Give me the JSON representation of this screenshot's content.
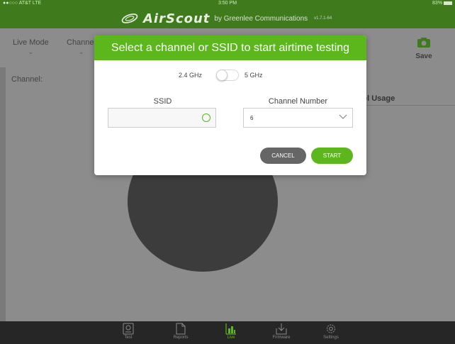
{
  "status_bar": {
    "carrier": "●●○○○ AT&T  LTE",
    "time": "3:50 PM",
    "battery": "83%"
  },
  "header": {
    "brand": "AirScout",
    "byline": "by Greenlee Communications",
    "version": "v1.7.1-64"
  },
  "toolbar": {
    "live_mode": "Live Mode",
    "channel": "Channel",
    "save": "Save"
  },
  "main": {
    "channel_label": "Channel:",
    "usage_label": "el Usage"
  },
  "modal": {
    "title": "Select a channel or SSID to start airtime testing",
    "band_left": "2.4 GHz",
    "band_right": "5 GHz",
    "ssid_label": "SSID",
    "ssid_value": "",
    "channel_label": "Channel Number",
    "channel_value": "6",
    "cancel": "CANCEL",
    "start": "START"
  },
  "tabs": [
    {
      "label": "Test"
    },
    {
      "label": "Reports"
    },
    {
      "label": "Live"
    },
    {
      "label": "Firmware"
    },
    {
      "label": "Settings"
    }
  ],
  "colors": {
    "accent": "#5bb71c",
    "dim_accent": "#3f7a1c",
    "cancel": "#666666"
  }
}
